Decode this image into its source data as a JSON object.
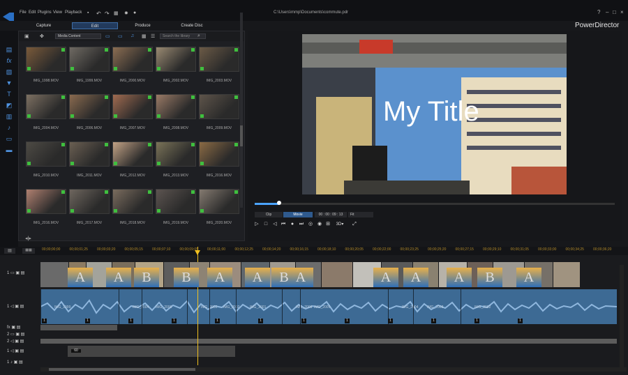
{
  "app": {
    "title": "PowerDirector",
    "file_path": "C:\\Users\\mmp\\Documents\\commute.pdr",
    "menu": [
      "File",
      "Edit",
      "Plugins",
      "View",
      "Playback"
    ],
    "window_controls": [
      "?",
      "–",
      "□",
      "×"
    ]
  },
  "mode_tabs": [
    "Capture",
    "Edit",
    "Produce",
    "Create Disc"
  ],
  "library": {
    "filter": "Media Content",
    "search_placeholder": "Search the library",
    "items": [
      {
        "name": "IMG_1998.MOV",
        "color": "#7a5a3a"
      },
      {
        "name": "IMG_1999.MOV",
        "color": "#6f6a63"
      },
      {
        "name": "IMG_2000.MOV",
        "color": "#8b6d52"
      },
      {
        "name": "IMG_2002.MOV",
        "color": "#9a8a72"
      },
      {
        "name": "IMG_2003.MOV",
        "color": "#6b5a46"
      },
      {
        "name": "IMG_2004.MOV",
        "color": "#7d7062"
      },
      {
        "name": "IMG_2006.MOV",
        "color": "#8a6a4f"
      },
      {
        "name": "IMG_2007.MOV",
        "color": "#a06a50"
      },
      {
        "name": "IMG_2008.MOV",
        "color": "#9a7a66"
      },
      {
        "name": "IMG_2009.MOV",
        "color": "#5e544a"
      },
      {
        "name": "IMG_2010.MOV",
        "color": "#4d4a44"
      },
      {
        "name": "IMG_2011.MOV",
        "color": "#6a5f52"
      },
      {
        "name": "IMG_2012.MOV",
        "color": "#c2a285"
      },
      {
        "name": "IMG_2013.MOV",
        "color": "#7a7358"
      },
      {
        "name": "IMG_2016.MOV",
        "color": "#8b6a44"
      },
      {
        "name": "IMG_2016.MOV",
        "color": "#b08070"
      },
      {
        "name": "IMG_2017.MOV",
        "color": "#6e665e"
      },
      {
        "name": "IMG_2018.MOV",
        "color": "#7a6c5e"
      },
      {
        "name": "IMG_2019.MOV",
        "color": "#5c5450"
      },
      {
        "name": "IMG_2020.MOV",
        "color": "#847a70"
      }
    ]
  },
  "preview": {
    "title_text": "My Title",
    "clip_label": "Clip",
    "movie_label": "Movie",
    "timecode": "00 : 00 : 09 : 13",
    "fit_label": "Fit",
    "progress_fraction": 0.07
  },
  "timeline": {
    "ruler": [
      "00;00;00;00",
      "00;00;01;25",
      "00;00;03;20",
      "00;00;05;15",
      "00;00;07;10",
      "00;00;09;05",
      "00;00;11;00",
      "00;00;12;25",
      "00;00;14;20",
      "00;00;16;15",
      "00;00;18;10",
      "00;00;20;05",
      "00;00;22;00",
      "00;00;23;25",
      "00;00;25;20",
      "00;00;27;15",
      "00;00;29;10",
      "00;00;31;05",
      "00;00;33;00",
      "00;00;34;25",
      "00;00;36;20"
    ],
    "audio_labels": [
      "IMG_1999",
      "IMG_2004",
      "IMG_2000",
      "IMG_2002",
      "IMG_2002",
      "IMG_2001",
      "IMG_2008",
      "IMG_2009",
      "IMG_2004",
      "IMG_2008",
      "IMG_2002"
    ],
    "clip_markers": [
      "1",
      "1",
      "1",
      "1",
      "1",
      "1",
      "1",
      "1",
      "1",
      "1",
      "1",
      "1"
    ],
    "voice_marker": "60"
  },
  "colors": {
    "accent": "#4f93e0",
    "audio": "#3d6a94",
    "playhead": "#f0c020"
  }
}
